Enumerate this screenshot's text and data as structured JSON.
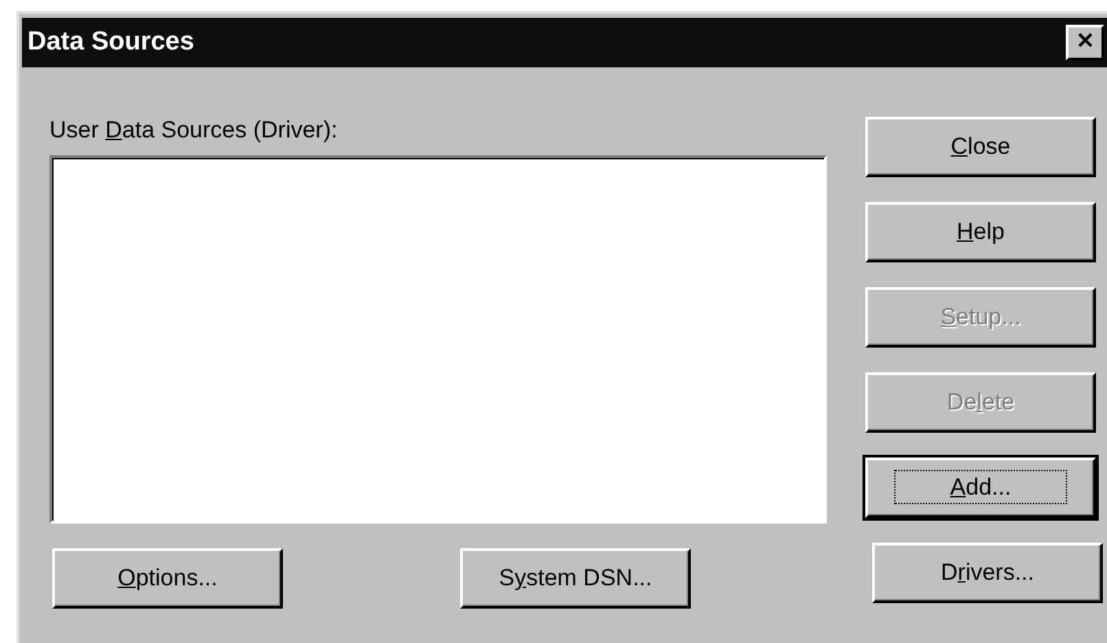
{
  "window": {
    "title": "Data Sources",
    "close_glyph": "✕"
  },
  "list": {
    "label": {
      "pre": "User ",
      "key": "D",
      "post": "ata Sources (Driver):"
    }
  },
  "side_buttons": [
    {
      "label": {
        "key": "C",
        "post": "lose"
      },
      "disabled": false,
      "default": false
    },
    {
      "label": {
        "key": "H",
        "post": "elp"
      },
      "disabled": false,
      "default": false
    },
    {
      "label": {
        "key": "S",
        "post": "etup..."
      },
      "disabled": true,
      "default": false
    },
    {
      "label": {
        "pre": "De",
        "key": "l",
        "post": "ete"
      },
      "disabled": true,
      "default": false
    },
    {
      "label": {
        "key": "A",
        "post": "dd..."
      },
      "disabled": false,
      "default": true
    },
    {
      "label": {
        "pre": "D",
        "key": "r",
        "post": "ivers..."
      },
      "disabled": false,
      "default": false
    }
  ],
  "bottom_buttons": [
    {
      "label": {
        "key": "O",
        "post": "ptions..."
      },
      "disabled": false,
      "default": false
    },
    {
      "label": {
        "pre": "S",
        "key": "y",
        "post": "stem DSN..."
      },
      "disabled": false,
      "default": false
    }
  ]
}
